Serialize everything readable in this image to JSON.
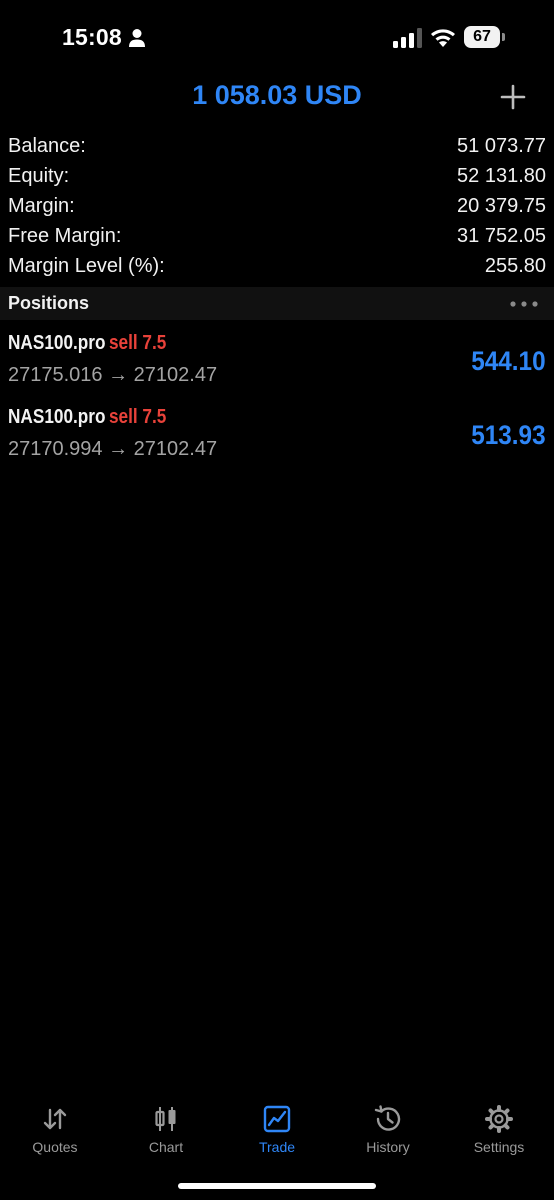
{
  "status_bar": {
    "time": "15:08",
    "battery_level": "67"
  },
  "header": {
    "amount": "1 058.03 USD"
  },
  "account": [
    {
      "label": "Balance:",
      "value": "51 073.77"
    },
    {
      "label": "Equity:",
      "value": "52 131.80"
    },
    {
      "label": "Margin:",
      "value": "20 379.75"
    },
    {
      "label": "Free Margin:",
      "value": "31 752.05"
    },
    {
      "label": "Margin Level (%):",
      "value": "255.80"
    }
  ],
  "positions": {
    "title": "Positions",
    "items": [
      {
        "symbol": "NAS100.pro",
        "side": "sell 7.5",
        "prices": "27175.016 → 27102.47",
        "profit": "544.10"
      },
      {
        "symbol": "NAS100.pro",
        "side": "sell 7.5",
        "prices": "27170.994 → 27102.47",
        "profit": "513.93"
      }
    ]
  },
  "tabs": [
    {
      "label": "Quotes",
      "icon": "quotes-icon"
    },
    {
      "label": "Chart",
      "icon": "chart-icon"
    },
    {
      "label": "Trade",
      "icon": "trade-icon",
      "active": true
    },
    {
      "label": "History",
      "icon": "history-icon"
    },
    {
      "label": "Settings",
      "icon": "settings-icon"
    }
  ],
  "colors": {
    "accent": "#2f86f6",
    "sell": "#e8423a",
    "background": "#000000"
  }
}
